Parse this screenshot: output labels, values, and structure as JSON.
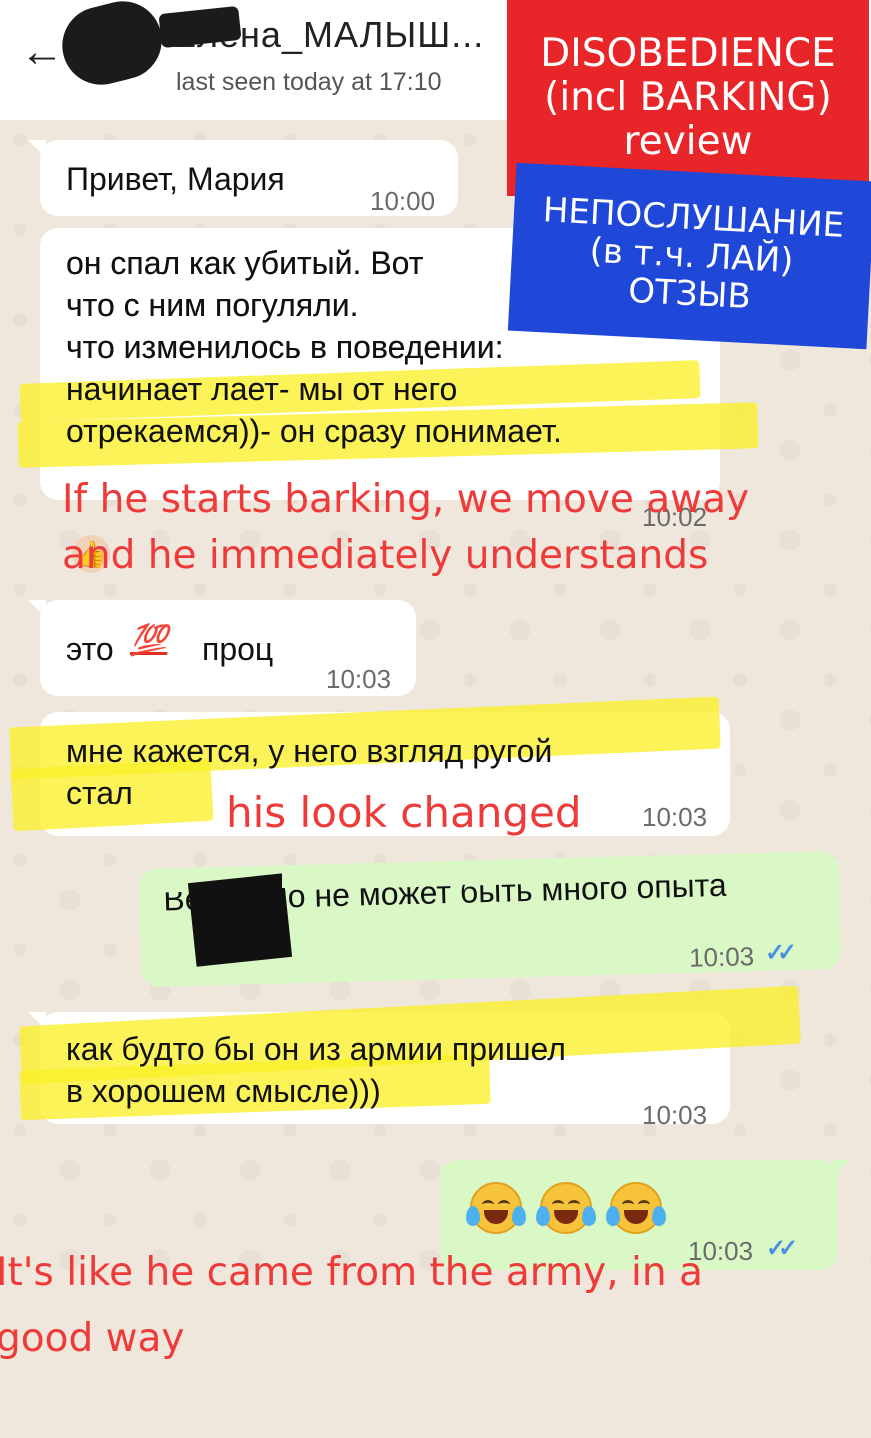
{
  "header": {
    "back_icon": "back-arrow-icon",
    "contact_name": "Елена_МАЛЫШ...",
    "last_seen": "last seen today at 17:10"
  },
  "messages": [
    {
      "text": "Привет, Мария",
      "time": "10:00"
    },
    {
      "text": "он спал как убитый. Вот\nчто с ним погуляли.\nчто изменилось в поведении:\nначинает лает- мы от него\nотрекаемся))- он сразу понимает.",
      "time": "10:02"
    },
    {
      "text": "это",
      "emoji": "💯",
      "text2": "проц",
      "time": "10:03"
    },
    {
      "text": "мне кажется, у него взгляд ругой\nстал",
      "time": "10:03"
    },
    {
      "text": "Вероятно не может быть много опыта\nбыло",
      "time": "10:03",
      "outgoing": true,
      "read": true
    },
    {
      "text": "как будто бы он из армии пришел\nв хорошем смысле)))",
      "time": "10:03"
    },
    {
      "emoji_count": 3,
      "emoji_name": "face-with-tears-of-joy",
      "time": "10:03",
      "outgoing": true,
      "read": true
    }
  ],
  "annotations": {
    "barking_note": "If he starts barking, we move away\nand he immediately understands",
    "look_note": "his look changed",
    "army_note": "It's like he came from the army, in a\ngood way"
  },
  "stickers": {
    "english": [
      "DISOBEDIENCE",
      "(incl BARKING)",
      "review"
    ],
    "russian": [
      "НЕПОСЛУШАНИЕ",
      "(в т.ч. ЛАЙ)",
      "ОТЗЫВ"
    ]
  },
  "colors": {
    "incoming_bubble": "#ffffff",
    "outgoing_bubble": "#d9f8c6",
    "annotation_red": "#ef3a3a",
    "sticker_red": "#e8262a",
    "sticker_blue": "#1f47d8",
    "highlight_yellow": "#faf028"
  }
}
